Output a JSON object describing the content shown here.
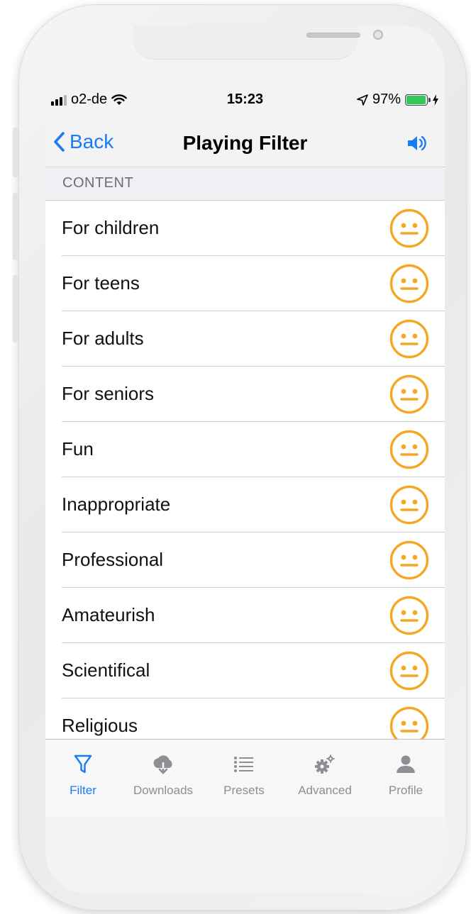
{
  "status_bar": {
    "carrier": "o2-de",
    "time": "15:23",
    "battery": "97%",
    "battery_level": 0.97
  },
  "nav": {
    "back_label": "Back",
    "title": "Playing Filter",
    "sound_icon": "speaker-icon"
  },
  "section_header": "CONTENT",
  "rows": [
    {
      "label": "For children",
      "icon": "neutral-face-icon"
    },
    {
      "label": "For teens",
      "icon": "neutral-face-icon"
    },
    {
      "label": "For adults",
      "icon": "neutral-face-icon"
    },
    {
      "label": "For seniors",
      "icon": "neutral-face-icon"
    },
    {
      "label": "Fun",
      "icon": "neutral-face-icon"
    },
    {
      "label": "Inappropriate",
      "icon": "neutral-face-icon"
    },
    {
      "label": "Professional",
      "icon": "neutral-face-icon"
    },
    {
      "label": "Amateurish",
      "icon": "neutral-face-icon"
    },
    {
      "label": "Scientifical",
      "icon": "neutral-face-icon"
    },
    {
      "label": "Religious",
      "icon": "neutral-face-icon"
    }
  ],
  "tabs": [
    {
      "label": "Filter",
      "icon": "filter-icon",
      "active": true
    },
    {
      "label": "Downloads",
      "icon": "cloud-download-icon",
      "active": false
    },
    {
      "label": "Presets",
      "icon": "list-icon",
      "active": false
    },
    {
      "label": "Advanced",
      "icon": "gears-icon",
      "active": false
    },
    {
      "label": "Profile",
      "icon": "person-icon",
      "active": false
    }
  ],
  "colors": {
    "accent": "#1a7cf5",
    "face": "#f5a623",
    "tab_inactive": "#8e8e93",
    "battery": "#34c759"
  }
}
